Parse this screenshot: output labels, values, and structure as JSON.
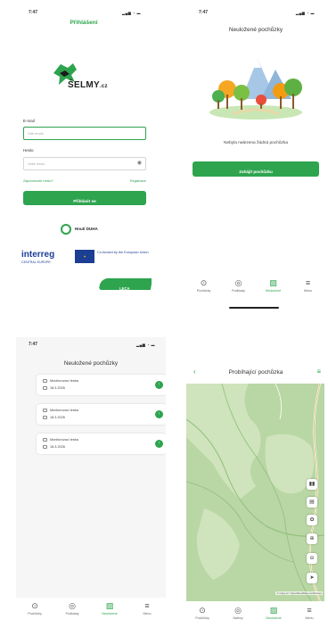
{
  "status_time": "7:47",
  "login": {
    "title": "Přihlášení",
    "logo_text": "ŠELMY",
    "logo_suffix": ".cz",
    "email_label": "E-mail",
    "email_placeholder": "Váš email",
    "password_label": "Heslo",
    "password_placeholder": "Vaše heslo",
    "forgot_password": "Zapomenuté heslo?",
    "register": "Registrace",
    "login_button": "Přihlásit se",
    "partner_name": "Hnutí DUHA",
    "interreg_name": "interreg",
    "interreg_region": "CENTRAL EUROPE",
    "eu_text": "Co-funded by the European Union",
    "language": "LECA"
  },
  "unsaved_empty": {
    "title": "Neuložené pochůzky",
    "empty_text": "Nebyla nalezena žádná pochůzka",
    "start_button": "Zahájit pochůzku"
  },
  "unsaved_list": {
    "title": "Neuložené pochůzky",
    "items": [
      {
        "label": "Monitorovací lesba",
        "date": "18.3.2026"
      },
      {
        "label": "Monitorovací lesba",
        "date": "18.3.2026"
      },
      {
        "label": "Monitorovací lesba",
        "date": "18.3.2026"
      }
    ]
  },
  "map": {
    "title": "Probíhající pochůzka",
    "attribution": "© mapy.cz / OpenStreetMap contributors"
  },
  "tabs_a": [
    {
      "label": "Pochůzky",
      "icon": "route-icon"
    },
    {
      "label": "Podklady",
      "icon": "target-icon"
    },
    {
      "label": "Neuložené",
      "icon": "map-icon"
    },
    {
      "label": "Menu",
      "icon": "menu-icon"
    }
  ],
  "tabs_b": [
    {
      "label": "Pochůzky",
      "icon": "route-icon"
    },
    {
      "label": "Nálezy",
      "icon": "target-icon"
    },
    {
      "label": "Neuložené",
      "icon": "map-icon"
    },
    {
      "label": "Menu",
      "icon": "menu-icon"
    }
  ],
  "colors": {
    "accent": "#2ea44f",
    "map_green": "#b9d6a5",
    "eu_blue": "#1c3f94"
  }
}
